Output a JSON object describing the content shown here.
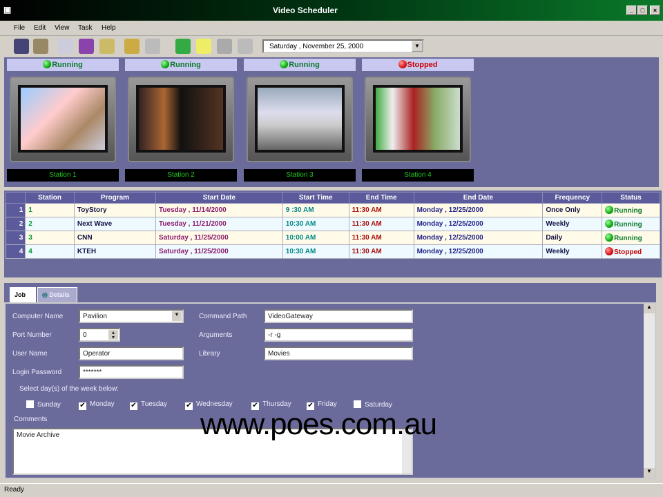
{
  "window": {
    "title": "Video Scheduler"
  },
  "menu": [
    "File",
    "Edit",
    "View",
    "Task",
    "Help"
  ],
  "toolbar": {
    "date": "Saturday  , November 25, 2000"
  },
  "monitors": [
    {
      "status": "Running",
      "state": "running",
      "label": "Station 1"
    },
    {
      "status": "Running",
      "state": "running",
      "label": "Station 2"
    },
    {
      "status": "Running",
      "state": "running",
      "label": "Station 3"
    },
    {
      "status": "Stopped",
      "state": "stopped",
      "label": "Station 4"
    }
  ],
  "grid": {
    "headers": [
      "Station",
      "Program",
      "Start Date",
      "Start Time",
      "End Time",
      "End Date",
      "Frequency",
      "Status"
    ],
    "rows": [
      {
        "n": "1",
        "station": "1",
        "program": "ToyStory",
        "start_date": "Tuesday   , 11/14/2000",
        "start_time": "9 :30 AM",
        "end_time": "11:30 AM",
        "end_date": "Monday   , 12/25/2000",
        "frequency": "Once Only",
        "status": "Running"
      },
      {
        "n": "2",
        "station": "2",
        "program": "Next Wave",
        "start_date": "Tuesday   , 11/21/2000",
        "start_time": "10:30 AM",
        "end_time": "11:30 AM",
        "end_date": "Monday   , 12/25/2000",
        "frequency": "Weekly",
        "status": "Running"
      },
      {
        "n": "3",
        "station": "3",
        "program": "CNN",
        "start_date": "Saturday  , 11/25/2000",
        "start_time": "10:00 AM",
        "end_time": "11:30 AM",
        "end_date": "Monday   , 12/25/2000",
        "frequency": "Daily",
        "status": "Running"
      },
      {
        "n": "4",
        "station": "4",
        "program": "KTEH",
        "start_date": "Saturday  , 11/25/2000",
        "start_time": "10:30 AM",
        "end_time": "11:30 AM",
        "end_date": "Monday   , 12/25/2000",
        "frequency": "Weekly",
        "status": "Stopped"
      }
    ]
  },
  "tabs": [
    "Job",
    "Details"
  ],
  "form": {
    "computer_name_label": "Computer Name",
    "computer_name": "Pavilion",
    "port_label": "Port Number",
    "port": "0",
    "user_label": "User Name",
    "user": "Operator",
    "password_label": "Login Password",
    "password": "*******",
    "command_label": "Command Path",
    "command": "VideoGateway",
    "args_label": "Arguments",
    "args": "-r -g",
    "library_label": "Library",
    "library": "Movies",
    "days_label": "Select day(s) of the week below:",
    "days": [
      {
        "name": "Sunday",
        "checked": false
      },
      {
        "name": "Monday",
        "checked": true
      },
      {
        "name": "Tuesday",
        "checked": true
      },
      {
        "name": "Wednesday",
        "checked": true
      },
      {
        "name": "Thursday",
        "checked": true
      },
      {
        "name": "Friday",
        "checked": true
      },
      {
        "name": "Saturday",
        "checked": false
      }
    ],
    "comments_label": "Comments",
    "comments": "Movie Archive"
  },
  "statusbar": "Ready",
  "watermark": "www.poes.com.au"
}
